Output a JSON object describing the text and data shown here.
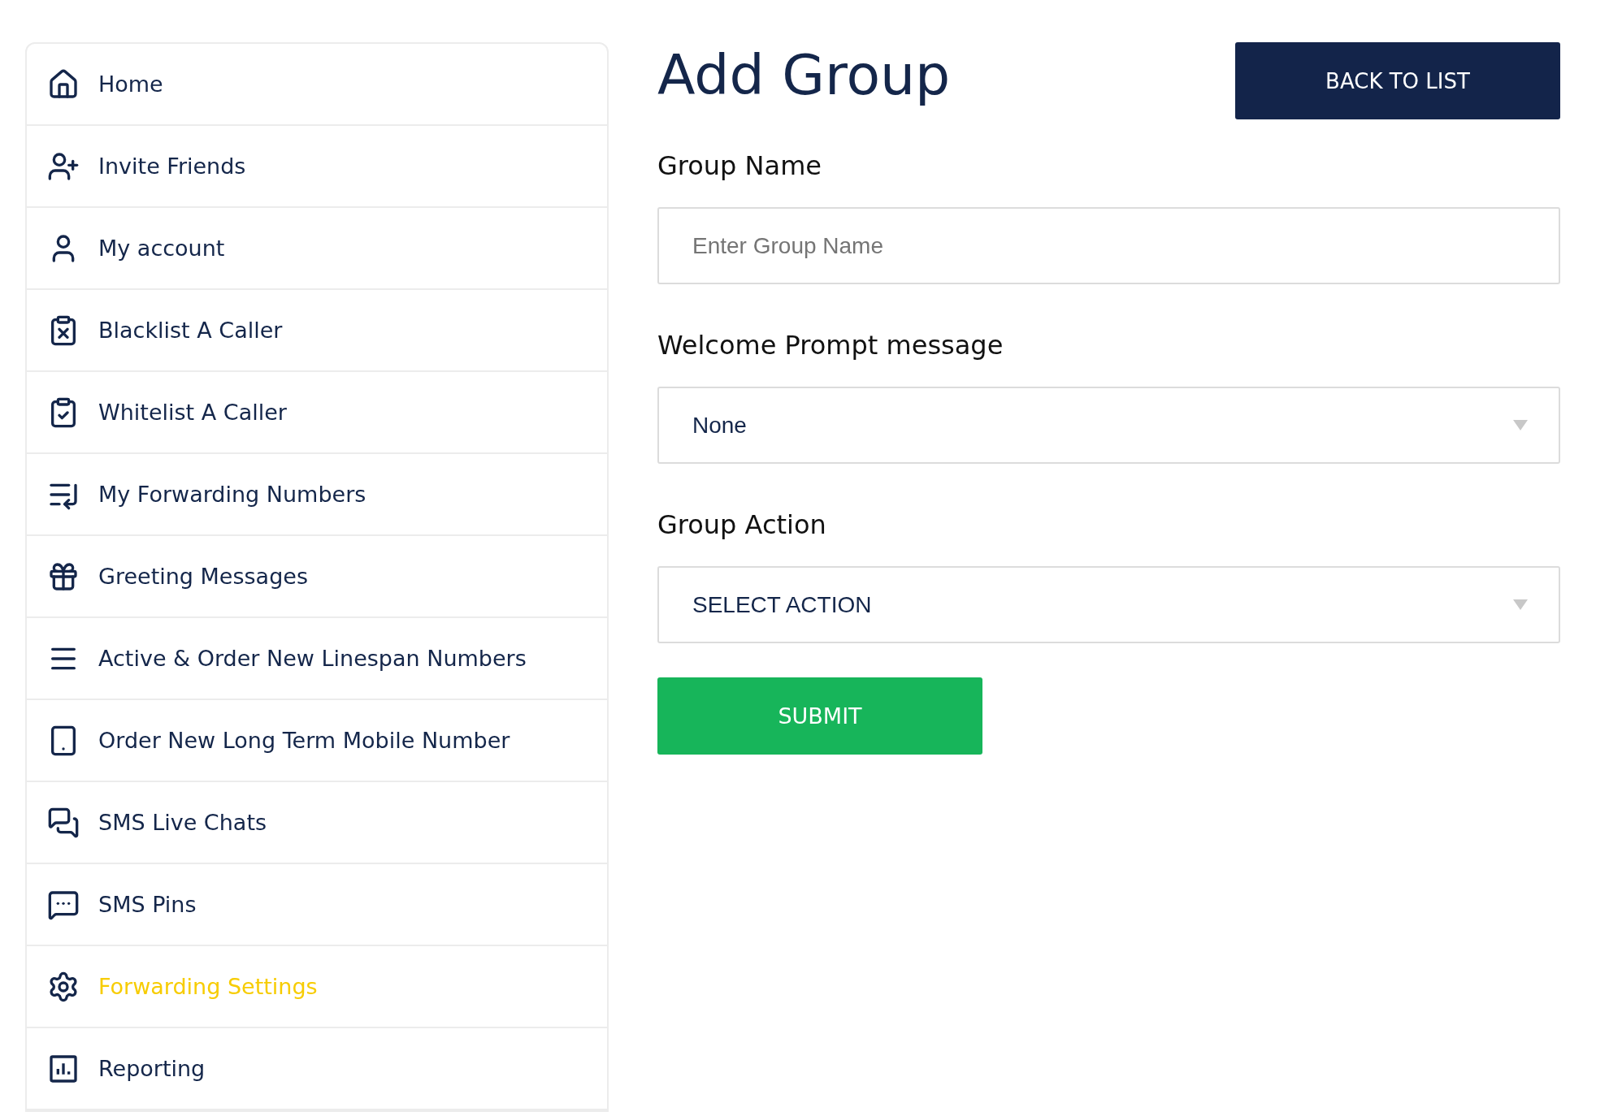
{
  "sidebar": {
    "items": [
      {
        "label": "Home",
        "selected": false
      },
      {
        "label": "Invite Friends",
        "selected": false
      },
      {
        "label": "My account",
        "selected": false
      },
      {
        "label": "Blacklist A Caller",
        "selected": false
      },
      {
        "label": "Whitelist A Caller",
        "selected": false
      },
      {
        "label": "My Forwarding Numbers",
        "selected": false
      },
      {
        "label": "Greeting Messages",
        "selected": false
      },
      {
        "label": "Active & Order New Linespan Numbers",
        "selected": false
      },
      {
        "label": "Order New Long Term Mobile Number",
        "selected": false
      },
      {
        "label": "SMS Live Chats",
        "selected": false
      },
      {
        "label": "SMS Pins",
        "selected": false
      },
      {
        "label": "Forwarding Settings",
        "selected": true
      },
      {
        "label": "Reporting",
        "selected": false
      }
    ]
  },
  "page": {
    "title": "Add Group",
    "back_button": "BACK TO LIST"
  },
  "form": {
    "fields": [
      {
        "kind": "text",
        "label": "Group Name",
        "placeholder": "Enter Group Name"
      },
      {
        "kind": "select",
        "label": "Welcome Prompt message",
        "value": "None"
      },
      {
        "kind": "select",
        "label": "Group Action",
        "value": "SELECT ACTION"
      }
    ],
    "submit": "SUBMIT"
  }
}
